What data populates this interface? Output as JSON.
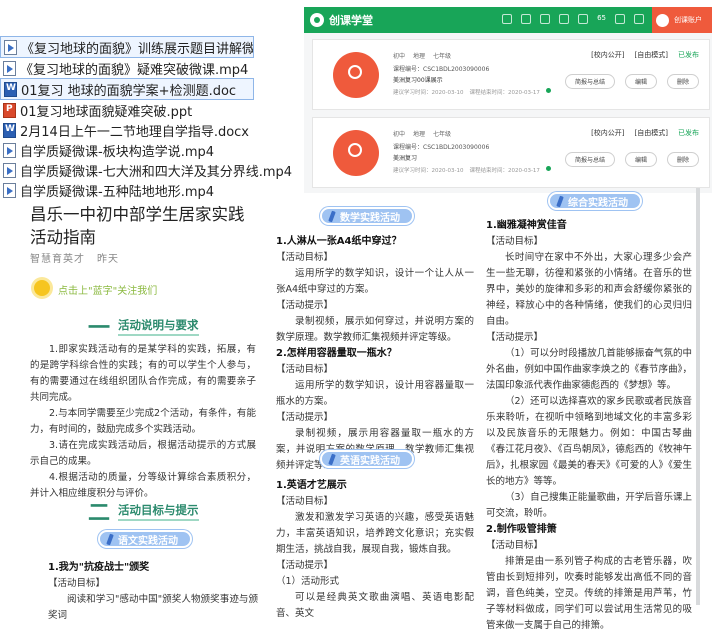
{
  "files": [
    {
      "name": "《复习地球的面貌》训练展示题目讲解微课.mp4",
      "icon": "video-file-icon",
      "selected": true
    },
    {
      "name": "《复习地球的面貌》疑难突破微课.mp4",
      "icon": "video-file-icon",
      "selected": false
    },
    {
      "name": "01复习 地球的面貌学案+检测题.doc",
      "icon": "word-doc-icon",
      "selected": true
    },
    {
      "name": "01复习地球面貌疑难突破.ppt",
      "icon": "ppt-file-icon",
      "selected": false
    },
    {
      "name": "2月14日上午一二节地理自学指导.docx",
      "icon": "word-doc-icon",
      "selected": false
    },
    {
      "name": "自学质疑微课-板块构造学说.mp4",
      "icon": "video-file-icon",
      "selected": false
    },
    {
      "name": "自学质疑微课-七大洲和四大洋及其分界线.mp4",
      "icon": "video-file-icon",
      "selected": false
    },
    {
      "name": "自学质疑微课-五种陆地地形.mp4",
      "icon": "video-file-icon",
      "selected": false
    }
  ],
  "platform": {
    "logo_text": "创课学堂",
    "user_label": "创课账户",
    "badge_count": "65",
    "accent": "#18a558",
    "user_bg": "#ef5a3c",
    "cards": [
      {
        "tags": [
          "初中",
          "地理",
          "七年级"
        ],
        "code": "课程编号：CSC1BDL2003090006",
        "title": "美洲复习00课展示",
        "time_created": "建议学习时间：2020-03-10",
        "time_end": "课程结束时间：2020-03-17",
        "flag_public": "[校内公开]",
        "flag_mode": "[自由模式]",
        "flag_status": "已发布",
        "btn_reflect": "简报与总结",
        "btn_edit": "编辑",
        "btn_delete": "删除"
      },
      {
        "tags": [
          "初中",
          "地理",
          "七年级"
        ],
        "code": "课程编号：CSC1BDL2003090006",
        "title": "美洲复习",
        "time_created": "建议学习时间：2020-03-10",
        "time_end": "课程结束时间：2020-03-17",
        "flag_public": "[校内公开]",
        "flag_mode": "[自由模式]",
        "flag_status": "已发布",
        "btn_reflect": "简报与总结",
        "btn_edit": "编辑",
        "btn_delete": "删除"
      }
    ]
  },
  "doc": {
    "title": "昌乐一中初中部学生居家实践活动指南",
    "author": "智慧育英才",
    "author2": "昨天",
    "tagline": "点击上\"蓝字\"关注我们",
    "section1": {
      "num": "一",
      "text": "活动说明与要求"
    },
    "col1_paras": [
      "1.即家实践活动有的是某学科的实践，拓展，有的是跨学科综合性的实践；有的可以学生个人参与，有的需要通过在线组织团队合作完成，有的需要亲子共同完成。",
      "2.与本同学需要至少完成2个活动，有条件，有能力，有时间的，鼓励完成多个实践活动。",
      "3.请在完成实践活动后，根据活动提示的方式展示自己的成果。",
      "4.根据活动的质量，分等级计算综合素质积分，并计入相应维度积分与评价。"
    ],
    "section2": {
      "num": "二",
      "text": "活动目标与提示"
    },
    "pill_chinese": "语文实践活动",
    "col1_item": "1.我为\"抗疫战士\"颁奖",
    "col1_item_label": "【活动目标】",
    "col1_item_text": "阅读和学习\"感动中国\"颁奖人物颁奖事迹与颁奖词",
    "pill_math": "数学实践活动",
    "col2_h1": "1.人淋从一张A4纸中穿过？",
    "col2_h1_label1": "【活动目标】",
    "col2_h1_text1": "运用所学的数学知识，设计一个让人从一张A4纸中穿过的方案。",
    "col2_h1_label2": "【活动提示】",
    "col2_h1_text2": "录制视频，展示如何穿过，并说明方案的数学原理。数学教师汇集视频并评定等级。",
    "col2_h2": "2.怎样用容器量取一瓶水？",
    "col2_h2_label1": "【活动目标】",
    "col2_h2_text1": "运用所学的数学知识，设计用容器量取一瓶水的方案。",
    "col2_h2_label2": "【活动提示】",
    "col2_h2_text2": "录制视频，展示用容器量取一瓶水的方案，并说明方案的数学原理。数学教师汇集视频并评定等级。",
    "pill_english": "英语实践活动",
    "col2_h3": "1.英语才艺展示",
    "col2_h3_label1": "【活动目标】",
    "col2_h3_text1": "激发和激发学习英语的兴趣，感受英语魅力，丰富英语知识，培养跨文化意识；充实假期生活，挑战自我，展现自我，锻炼自我。",
    "col2_h3_label2": "【活动提示】",
    "col2_h3_text2a": "（1）活动形式",
    "col2_h3_text2b": "可以是经典英文歌曲演唱、英语电影配音、英文",
    "pill_comprehensive": "综合实践活动",
    "col3_h1": "1.幽雅凝神赏佳音",
    "col3_h1_label1": "【活动目标】",
    "col3_h1_text1": "长时间守在家中不外出，大家心理多少会产生一些无聊，彷徨和紧张的小情绪。在音乐的世界中，美妙的旋律和多彩的和声会舒缓你紧张的神经，释放心中的各种情绪，使我们的心灵归归自由。",
    "col3_h1_label2": "【活动提示】",
    "col3_h1_text2": "（1）可以分时段播放几首能够振奋气氛的中外名曲，例如中国作曲家李焕之的《春节序曲》，法国印象派代表作曲家德彪西的《梦想》等。",
    "col3_h1_text3": "（2）还可以选择喜欢的家乡民歌或者民族音乐来聆听，在视听中领略到地域文化的丰富多彩以及民族音乐的无限魅力。例如：中国古琴曲《春江花月夜》、《百鸟朝凤》，德彪西的《牧神午后》，扎根家园《最美的春天》《可爱的人》《爱生长的地方》等等。",
    "col3_h1_text4": "（3）自己搜集正能量歌曲，开学后音乐课上可交流，聆听。",
    "col3_h2": "2.制作吸管排箫",
    "col3_h2_label1": "【活动目标】",
    "col3_h2_text1": "排箫是由一系列管子构成的古老管乐器，吹管由长到短排列，吹奏时能够发出高低不同的音调，音色纯美，空灵。传统的排箫是用芦苇，竹子等材料做成，同学们可以尝试用生活常见的吸管来做一支属于自己的排箫。"
  }
}
